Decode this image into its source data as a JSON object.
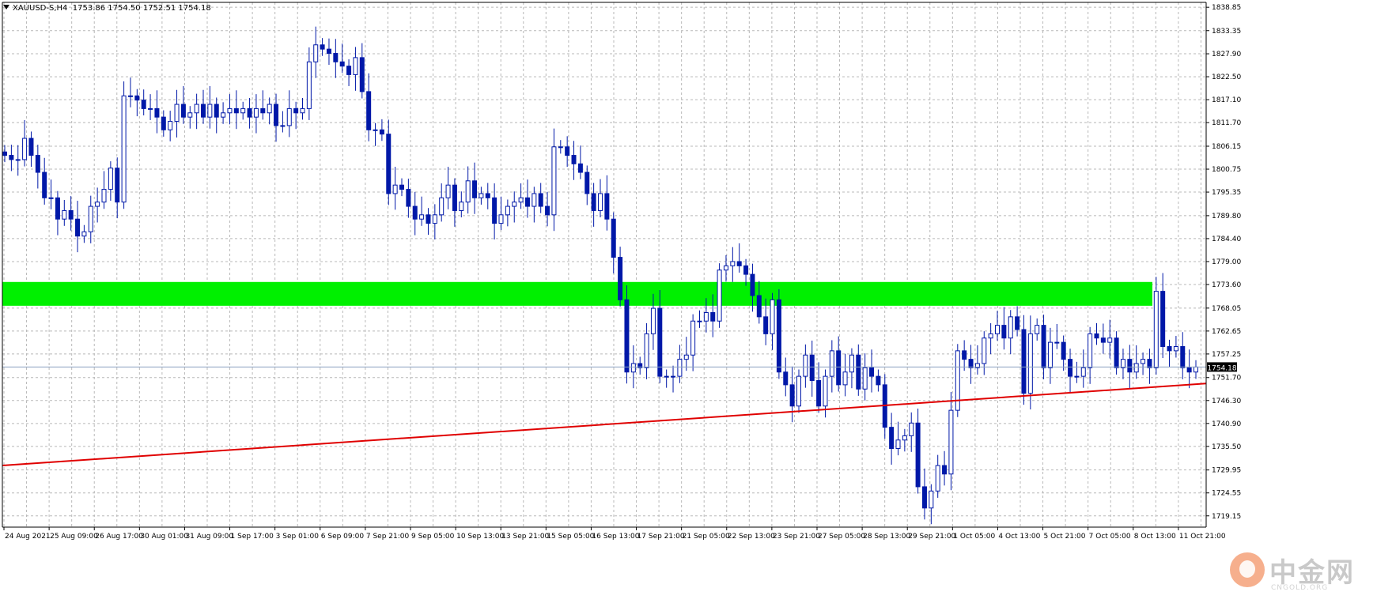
{
  "header": {
    "symbol": "XAUUSD-S,H4",
    "ohlc": "1753.86 1754.50 1752.51 1754.18"
  },
  "watermark": {
    "text": "中金网",
    "sub": "CNGOLD.ORG"
  },
  "colors": {
    "candle": "#0018a8",
    "grid": "#b8b8b8",
    "zone": "#00f000",
    "trendline": "#e00000",
    "price_line": "#8aa0c0"
  },
  "chart_data": {
    "type": "candlestick",
    "symbol": "XAUUSD-S",
    "timeframe": "H4",
    "ylim": [
      1716.5,
      1840.0
    ],
    "current_price": 1754.18,
    "y_ticks": [
      1838.85,
      1833.35,
      1827.9,
      1822.5,
      1817.1,
      1811.7,
      1806.15,
      1800.75,
      1795.35,
      1789.8,
      1784.4,
      1779.0,
      1773.6,
      1768.05,
      1762.65,
      1757.25,
      1751.7,
      1746.3,
      1740.9,
      1735.5,
      1729.95,
      1724.55,
      1719.15
    ],
    "x_labels": [
      "24 Aug 2021",
      "25 Aug 09:00",
      "26 Aug 17:00",
      "30 Aug 01:00",
      "31 Aug 09:00",
      "1 Sep 17:00",
      "3 Sep 01:00",
      "6 Sep 09:00",
      "7 Sep 21:00",
      "9 Sep 05:00",
      "10 Sep 13:00",
      "13 Sep 21:00",
      "15 Sep 05:00",
      "16 Sep 13:00",
      "17 Sep 21:00",
      "21 Sep 05:00",
      "22 Sep 13:00",
      "23 Sep 21:00",
      "27 Sep 05:00",
      "28 Sep 13:00",
      "29 Sep 21:00",
      "1 Oct 05:00",
      "4 Oct 13:00",
      "5 Oct 21:00",
      "7 Oct 05:00",
      "8 Oct 13:00",
      "11 Oct 21:00"
    ],
    "zone": {
      "low": 1768.6,
      "high": 1774.2,
      "color": "#00f000"
    },
    "trendline": {
      "start": 1731.0,
      "end": 1750.3,
      "color": "#e00000"
    },
    "closes": [
      1804.0,
      1803.0,
      1803.0,
      1808.0,
      1804.0,
      1800.0,
      1794.0,
      1794.0,
      1789.0,
      1791.0,
      1789.0,
      1785.0,
      1786.0,
      1792.0,
      1793.0,
      1796.0,
      1801.0,
      1793.0,
      1818.0,
      1818.0,
      1817.0,
      1815.0,
      1815.0,
      1813.0,
      1810.0,
      1812.0,
      1816.0,
      1813.0,
      1814.0,
      1816.0,
      1813.0,
      1816.0,
      1813.0,
      1814.0,
      1815.0,
      1814.0,
      1815.0,
      1813.0,
      1815.0,
      1814.0,
      1816.0,
      1811.0,
      1811.0,
      1815.0,
      1814.0,
      1815.0,
      1826.0,
      1830.0,
      1829.0,
      1828.0,
      1826.0,
      1825.0,
      1823.0,
      1827.0,
      1819.0,
      1810.0,
      1810.0,
      1809.0,
      1795.0,
      1797.0,
      1796.0,
      1792.0,
      1789.0,
      1790.0,
      1788.0,
      1790.0,
      1794.0,
      1797.0,
      1791.0,
      1793.0,
      1798.0,
      1794.0,
      1795.0,
      1794.0,
      1788.0,
      1790.0,
      1792.0,
      1793.0,
      1794.0,
      1792.0,
      1795.0,
      1792.0,
      1790.0,
      1806.0,
      1806.0,
      1804.0,
      1802.0,
      1800.0,
      1795.0,
      1791.0,
      1795.0,
      1789.0,
      1780.0,
      1770.0,
      1753.0,
      1755.0,
      1754.0,
      1762.0,
      1768.0,
      1752.0,
      1752.0,
      1752.0,
      1756.0,
      1757.0,
      1765.0,
      1765.0,
      1767.0,
      1765.0,
      1777.0,
      1778.0,
      1779.0,
      1778.0,
      1776.0,
      1771.0,
      1766.0,
      1762.0,
      1770.0,
      1753.0,
      1750.0,
      1745.0,
      1752.0,
      1757.0,
      1751.0,
      1745.0,
      1752.0,
      1758.0,
      1750.0,
      1753.0,
      1757.0,
      1749.0,
      1754.0,
      1752.0,
      1750.0,
      1740.0,
      1735.0,
      1737.0,
      1738.0,
      1741.0,
      1726.0,
      1721.0,
      1725.0,
      1731.0,
      1729.0,
      1744.0,
      1758.0,
      1756.0,
      1754.0,
      1755.0,
      1761.0,
      1762.0,
      1764.0,
      1761.0,
      1766.0,
      1763.0,
      1748.0,
      1762.0,
      1764.0,
      1754.0,
      1760.0,
      1760.0,
      1756.0,
      1752.0,
      1752.0,
      1754.0,
      1762.0,
      1761.0,
      1760.0,
      1761.0,
      1754.0,
      1756.0,
      1753.0,
      1755.0,
      1756.0,
      1754.0,
      1772.0,
      1759.0,
      1758.0,
      1759.0,
      1754.0,
      1753.0,
      1754.18
    ]
  }
}
